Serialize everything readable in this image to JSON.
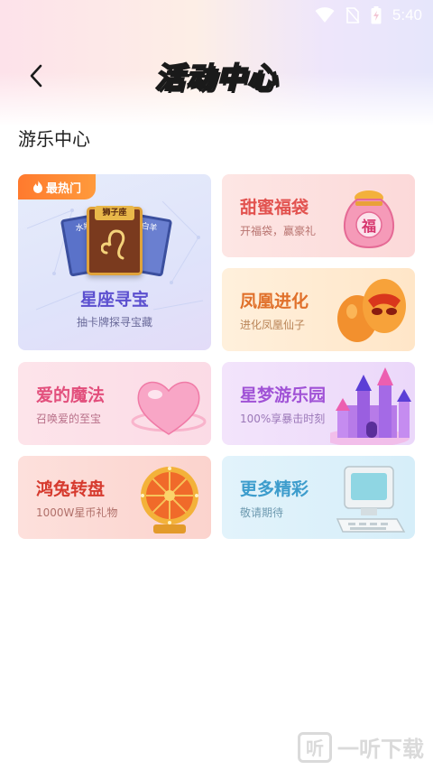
{
  "status_bar": {
    "time": "5:40"
  },
  "header": {
    "title": "活动中心",
    "back_icon": "chevron-left-icon"
  },
  "section": {
    "title": "游乐中心"
  },
  "cards": {
    "xingzuo": {
      "badge": "最热门",
      "art_label": "狮子座",
      "art_left": "水瓶",
      "art_right": "白羊",
      "title": "星座寻宝",
      "subtitle": "抽卡牌探寻宝藏"
    },
    "tianmi": {
      "title": "甜蜜福袋",
      "subtitle": "开福袋，赢豪礼",
      "art_label": "福"
    },
    "fenghuang": {
      "title": "凤凰进化",
      "subtitle": "进化凤凰仙子"
    },
    "aide": {
      "title": "爱的魔法",
      "subtitle": "召唤爱的至宝"
    },
    "xingmeng": {
      "title": "星梦游乐园",
      "subtitle": "100%享暴击时刻"
    },
    "hongtu": {
      "title": "鸿兔转盘",
      "subtitle": "1000W星币礼物"
    },
    "gengduo": {
      "title": "更多精彩",
      "subtitle": "敬请期待"
    }
  },
  "watermark": {
    "text": "一听下载",
    "icon_text": "听"
  },
  "colors": {
    "accent_hot": "#ff7a2e",
    "xingzuo": "#5b4fcf",
    "tianmi": "#e2524f",
    "fenghuang": "#e0702a",
    "aide": "#e24f7c",
    "xingmeng": "#a052d6",
    "hongtu": "#d63a2e",
    "gengduo": "#3c9ccc"
  }
}
